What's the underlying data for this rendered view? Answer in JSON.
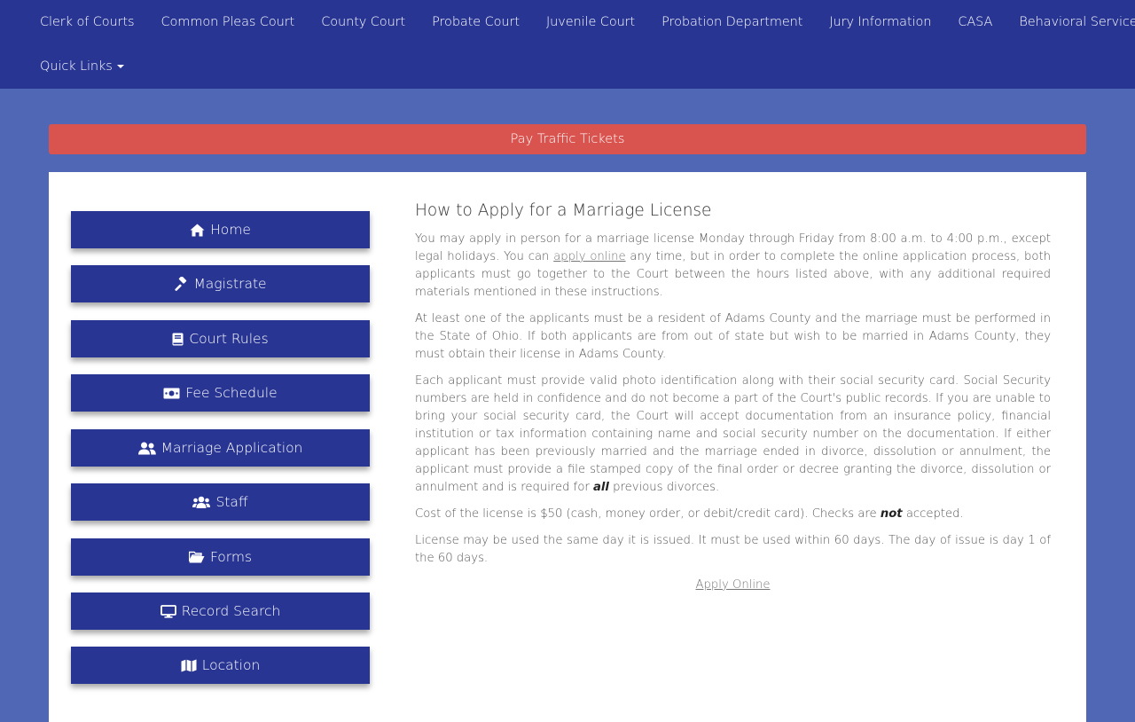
{
  "nav": {
    "items": [
      {
        "label": "Clerk of Courts"
      },
      {
        "label": "Common Pleas Court"
      },
      {
        "label": "County Court"
      },
      {
        "label": "Probate Court"
      },
      {
        "label": "Juvenile Court"
      },
      {
        "label": "Probation Department"
      },
      {
        "label": "Jury Information"
      },
      {
        "label": "CASA"
      },
      {
        "label": "Behavioral Services"
      }
    ],
    "quick_links": "Quick Links"
  },
  "alert": {
    "label": "Pay Traffic Tickets"
  },
  "sidebar": {
    "items": [
      {
        "label": "Home",
        "icon": "home-icon"
      },
      {
        "label": "Magistrate",
        "icon": "gavel-icon"
      },
      {
        "label": "Court Rules",
        "icon": "book-icon"
      },
      {
        "label": "Fee Schedule",
        "icon": "money-bill-icon"
      },
      {
        "label": "Marriage Application",
        "icon": "user-friends-icon"
      },
      {
        "label": "Staff",
        "icon": "users-icon"
      },
      {
        "label": "Forms",
        "icon": "folder-open-icon"
      },
      {
        "label": "Record Search",
        "icon": "desktop-icon"
      },
      {
        "label": "Location",
        "icon": "map-icon"
      }
    ]
  },
  "content": {
    "title": "How to Apply for a Marriage License",
    "p1_a": "You may apply in person for a marriage license Monday through Friday from 8:00 a.m. to 4:00 p.m., except legal holidays. You can ",
    "p1_link": "apply online",
    "p1_b": " any time, but in order to complete the online application process, both applicants must go together to the Court between the hours listed above, with any additional required materials mentioned in these instructions.",
    "p2": "At least one of the applicants must be a resident of Adams County and the marriage must be performed in the State of Ohio. If both applicants are from out of state but wish to be married in Adams County, they must obtain their license in Adams County.",
    "p3_a": "Each applicant must provide valid photo identification along with their social security card. Social Security numbers are held in confidence and do not become a part of the Court's public records. If you are unable to bring your social security card, the Court will accept documentation from an insurance policy, financial institution or tax information containing name and social security number on the documentation. If either applicant has been previously married and the marriage ended in divorce, dissolution or annulment, the applicant must provide a file stamped copy of the final order or decree granting the divorce, dissolution or annulment and is required for ",
    "p3_bold": "all",
    "p3_b": " previous divorces.",
    "p4_a": "Cost of the license is $50 (cash, money order, or debit/credit card). Checks are ",
    "p4_bold": "not",
    "p4_b": " accepted.",
    "p5": "License may be used the same day it is issued. It must be used within 60 days. The day of issue is day 1 of the 60 days.",
    "apply_link": "Apply Online"
  }
}
